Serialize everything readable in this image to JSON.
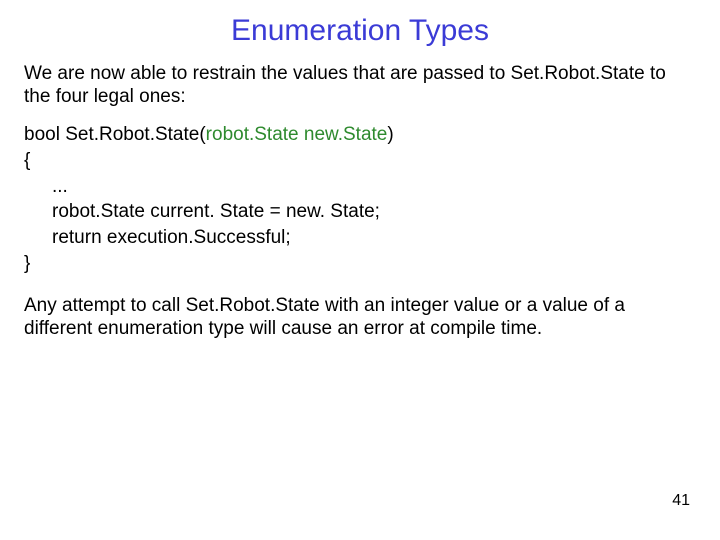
{
  "title": "Enumeration Types",
  "intro": "We are now able to restrain the values that are passed to Set.Robot.State to the four legal ones:",
  "code": {
    "line1_prefix": "bool Set.Robot.State(",
    "line1_param": "robot.State new.State",
    "line1_suffix": ")",
    "line2": "{",
    "line3": "...",
    "line4": "robot.State current. State = new. State;",
    "line5": "return execution.Successful;",
    "line6": "}"
  },
  "outro": "Any attempt to call Set.Robot.State with an integer value or a value of a different enumeration type will cause an error at compile time.",
  "page_number": "41"
}
